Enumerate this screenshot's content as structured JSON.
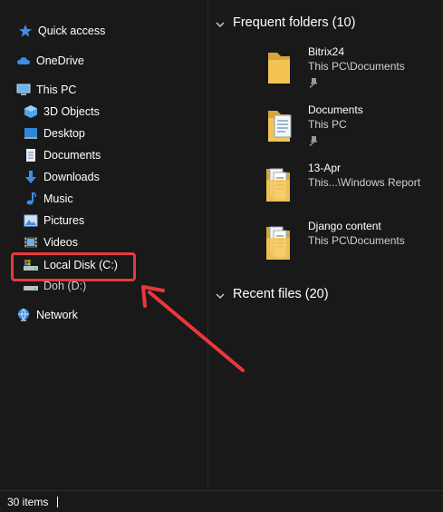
{
  "sidebar": {
    "quick_access": "Quick access",
    "onedrive": "OneDrive",
    "this_pc": "This PC",
    "items": [
      {
        "label": "3D Objects",
        "icon": "3d-objects-icon"
      },
      {
        "label": "Desktop",
        "icon": "desktop-icon"
      },
      {
        "label": "Documents",
        "icon": "documents-icon"
      },
      {
        "label": "Downloads",
        "icon": "downloads-icon"
      },
      {
        "label": "Music",
        "icon": "music-icon"
      },
      {
        "label": "Pictures",
        "icon": "pictures-icon"
      },
      {
        "label": "Videos",
        "icon": "videos-icon"
      },
      {
        "label": "Local Disk (C:)",
        "icon": "local-disk-icon"
      },
      {
        "label": "Doh (D:)",
        "icon": "drive-icon"
      }
    ],
    "network": "Network"
  },
  "main": {
    "frequent_header": "Frequent folders (10)",
    "folders": [
      {
        "name": "Bitrix24",
        "path": "This PC\\Documents",
        "pinned": true
      },
      {
        "name": "Documents",
        "path": "This PC",
        "pinned": true
      },
      {
        "name": "13-Apr",
        "path": "This...\\Windows Report",
        "pinned": false
      },
      {
        "name": "Django content",
        "path": "This PC\\Documents",
        "pinned": false
      }
    ],
    "recent_header": "Recent files (20)"
  },
  "status": {
    "item_count": "30 items"
  },
  "colors": {
    "background": "#191919",
    "highlight": "#e8383d",
    "folder": "#f3c454",
    "accent_blue": "#3a8ee6"
  }
}
